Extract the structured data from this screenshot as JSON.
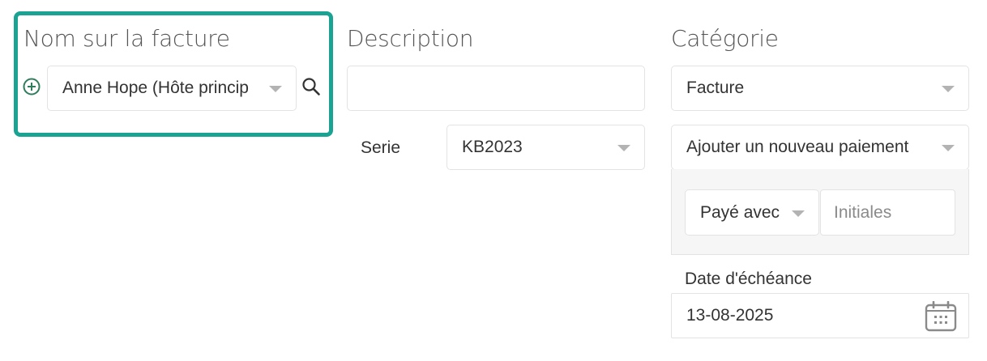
{
  "invoice_name": {
    "heading": "Nom sur la facture",
    "selected": "Anne Hope (Hôte princip",
    "add_icon": "plus-circle-icon",
    "search_icon": "search-icon"
  },
  "description": {
    "heading": "Description",
    "value": ""
  },
  "serie": {
    "label": "Serie",
    "selected": "KB2023"
  },
  "category": {
    "heading": "Catégorie",
    "selected": "Facture"
  },
  "payment": {
    "selected": "Ajouter un nouveau paiement",
    "paid_with": "Payé avec",
    "initials_placeholder": "Initiales"
  },
  "due_date": {
    "label": "Date d'échéance",
    "value": "13-08-2025",
    "icon": "calendar-icon"
  },
  "colors": {
    "highlight": "#1aa293",
    "icon_green": "#2e7d5b"
  }
}
